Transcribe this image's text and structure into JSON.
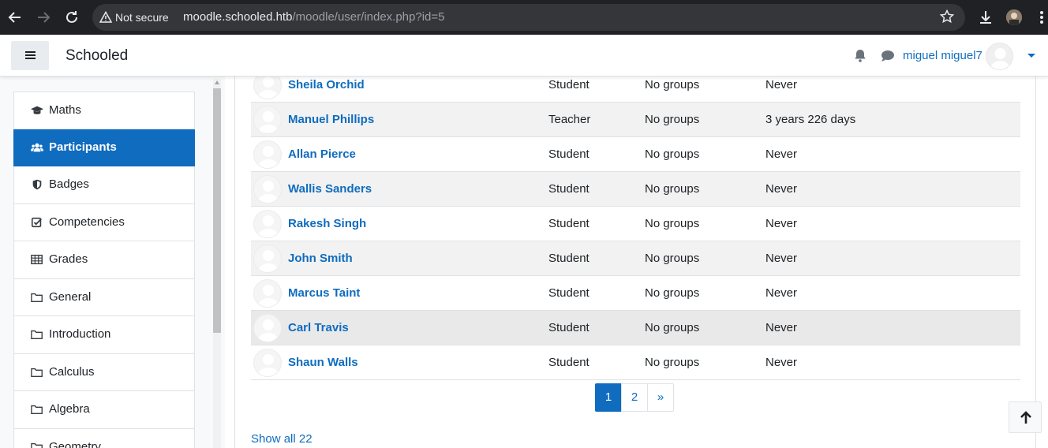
{
  "browser": {
    "security_label": "Not secure",
    "url_host": "moodle.schooled.htb",
    "url_path": "/moodle/user/index.php?id=5"
  },
  "navbar": {
    "site_name": "Schooled",
    "user_name": "miguel miguel7"
  },
  "drawer": {
    "items": [
      {
        "label": "Maths",
        "icon": "graduation-cap-icon",
        "active": false
      },
      {
        "label": "Participants",
        "icon": "users-icon",
        "active": true
      },
      {
        "label": "Badges",
        "icon": "shield-icon",
        "active": false
      },
      {
        "label": "Competencies",
        "icon": "check-square-icon",
        "active": false
      },
      {
        "label": "Grades",
        "icon": "table-icon",
        "active": false
      },
      {
        "label": "General",
        "icon": "folder-icon",
        "active": false
      },
      {
        "label": "Introduction",
        "icon": "folder-icon",
        "active": false
      },
      {
        "label": "Calculus",
        "icon": "folder-icon",
        "active": false
      },
      {
        "label": "Algebra",
        "icon": "folder-icon",
        "active": false
      },
      {
        "label": "Geometry",
        "icon": "folder-icon",
        "active": false
      }
    ]
  },
  "participants": {
    "rows": [
      {
        "name": "Sheila Orchid",
        "role": "Student",
        "groups": "No groups",
        "last_access": "Never"
      },
      {
        "name": "Manuel Phillips",
        "role": "Teacher",
        "groups": "No groups",
        "last_access": "3 years 226 days"
      },
      {
        "name": "Allan Pierce",
        "role": "Student",
        "groups": "No groups",
        "last_access": "Never"
      },
      {
        "name": "Wallis Sanders",
        "role": "Student",
        "groups": "No groups",
        "last_access": "Never"
      },
      {
        "name": "Rakesh Singh",
        "role": "Student",
        "groups": "No groups",
        "last_access": "Never"
      },
      {
        "name": "John Smith",
        "role": "Student",
        "groups": "No groups",
        "last_access": "Never"
      },
      {
        "name": "Marcus Taint",
        "role": "Student",
        "groups": "No groups",
        "last_access": "Never"
      },
      {
        "name": "Carl Travis",
        "role": "Student",
        "groups": "No groups",
        "last_access": "Never"
      },
      {
        "name": "Shaun Walls",
        "role": "Student",
        "groups": "No groups",
        "last_access": "Never"
      }
    ],
    "pagination": [
      "1",
      "2",
      "»"
    ],
    "current_page": "1",
    "show_all": "Show all 22"
  },
  "colors": {
    "accent": "#0f6cbf",
    "chrome_bg": "#202124"
  }
}
